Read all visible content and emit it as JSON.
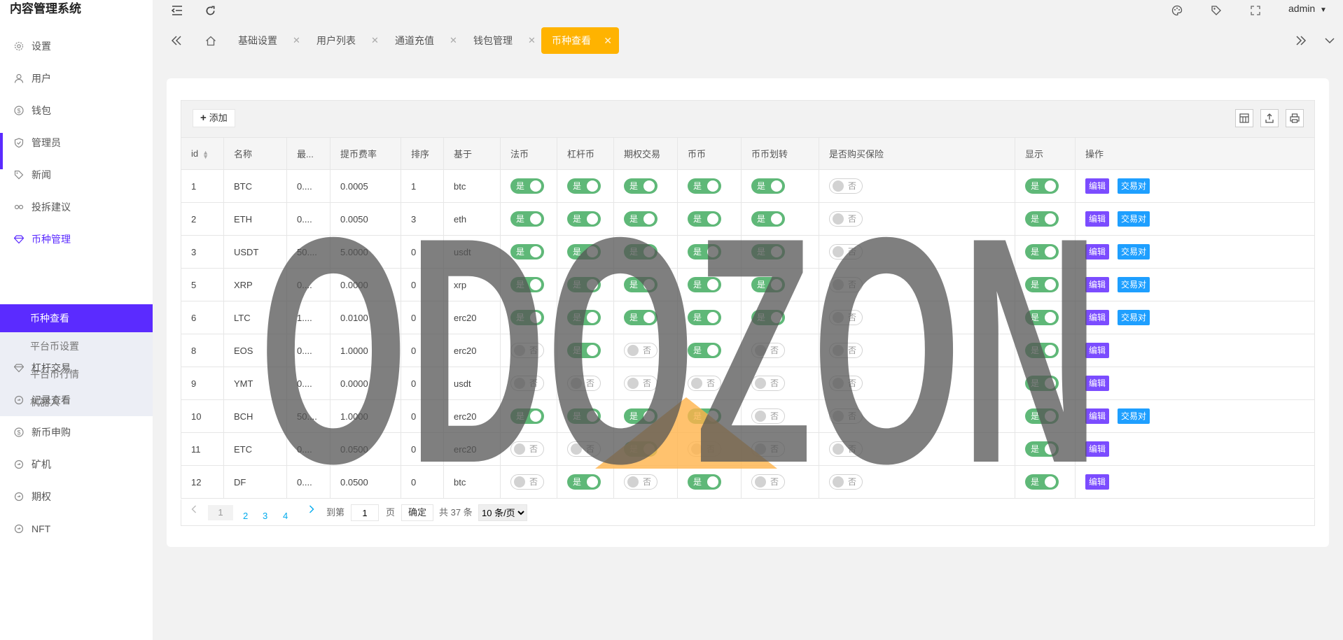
{
  "app": {
    "title": "内容管理系统"
  },
  "sidebar": {
    "items": [
      {
        "label": "设置",
        "icon": "gear-icon"
      },
      {
        "label": "用户",
        "icon": "user-icon"
      },
      {
        "label": "钱包",
        "icon": "dollar-icon"
      },
      {
        "label": "管理员",
        "icon": "shield-icon"
      },
      {
        "label": "新闻",
        "icon": "tag-icon"
      },
      {
        "label": "投拆建议",
        "icon": "link-icon"
      },
      {
        "label": "币种管理",
        "icon": "diamond-icon"
      },
      {
        "label": "杠杆交易",
        "icon": "diamond-icon"
      },
      {
        "label": "记录查看",
        "icon": "cycle-icon"
      },
      {
        "label": "新币申购",
        "icon": "dollar-icon"
      },
      {
        "label": "矿机",
        "icon": "cycle-icon"
      },
      {
        "label": "期权",
        "icon": "cycle-icon"
      },
      {
        "label": "NFT",
        "icon": "cycle-icon"
      }
    ],
    "sub_items": [
      "币种查看",
      "平台币设置",
      "平台币行情",
      "机器人"
    ]
  },
  "topbar": {
    "user": "admin"
  },
  "tabs": [
    "基础设置",
    "用户列表",
    "通道充值",
    "钱包管理"
  ],
  "active_tab": "币种查看",
  "toolbar": {
    "add_label": "添加"
  },
  "table": {
    "columns": [
      "id",
      "名称",
      "最...",
      "提币费率",
      "排序",
      "基于",
      "法币",
      "杠杆币",
      "期权交易",
      "币币",
      "币币划转",
      "是否购买保险",
      "显示",
      "操作"
    ],
    "on_label": "是",
    "off_label": "否",
    "edit_label": "编辑",
    "pair_label": "交易对",
    "rows": [
      {
        "id": "1",
        "name": "BTC",
        "min": "0....",
        "fee": "0.0005",
        "sort": "1",
        "base": "btc",
        "fiat": true,
        "lever": true,
        "option": true,
        "coin": true,
        "transfer": true,
        "insurance": false,
        "show": true,
        "pair": true
      },
      {
        "id": "2",
        "name": "ETH",
        "min": "0....",
        "fee": "0.0050",
        "sort": "3",
        "base": "eth",
        "fiat": true,
        "lever": true,
        "option": true,
        "coin": true,
        "transfer": true,
        "insurance": false,
        "show": true,
        "pair": true
      },
      {
        "id": "3",
        "name": "USDT",
        "min": "50....",
        "fee": "5.0000",
        "sort": "0",
        "base": "usdt",
        "fiat": true,
        "lever": true,
        "option": true,
        "coin": true,
        "transfer": true,
        "insurance": false,
        "show": true,
        "pair": true
      },
      {
        "id": "5",
        "name": "XRP",
        "min": "0....",
        "fee": "0.0000",
        "sort": "0",
        "base": "xrp",
        "fiat": true,
        "lever": true,
        "option": true,
        "coin": true,
        "transfer": true,
        "insurance": false,
        "show": true,
        "pair": true
      },
      {
        "id": "6",
        "name": "LTC",
        "min": "1....",
        "fee": "0.0100",
        "sort": "0",
        "base": "erc20",
        "fiat": true,
        "lever": true,
        "option": true,
        "coin": true,
        "transfer": true,
        "insurance": false,
        "show": true,
        "pair": true
      },
      {
        "id": "8",
        "name": "EOS",
        "min": "0....",
        "fee": "1.0000",
        "sort": "0",
        "base": "erc20",
        "fiat": false,
        "lever": true,
        "option": false,
        "coin": true,
        "transfer": false,
        "insurance": false,
        "show": true,
        "pair": false
      },
      {
        "id": "9",
        "name": "YMT",
        "min": "0....",
        "fee": "0.0000",
        "sort": "0",
        "base": "usdt",
        "fiat": false,
        "lever": false,
        "option": false,
        "coin": false,
        "transfer": false,
        "insurance": false,
        "show": true,
        "pair": false
      },
      {
        "id": "10",
        "name": "BCH",
        "min": "50....",
        "fee": "1.0000",
        "sort": "0",
        "base": "erc20",
        "fiat": true,
        "lever": true,
        "option": true,
        "coin": true,
        "transfer": false,
        "insurance": false,
        "show": true,
        "pair": true
      },
      {
        "id": "11",
        "name": "ETC",
        "min": "0....",
        "fee": "0.0500",
        "sort": "0",
        "base": "erc20",
        "fiat": false,
        "lever": false,
        "option": true,
        "coin": false,
        "transfer": false,
        "insurance": false,
        "show": true,
        "pair": false
      },
      {
        "id": "12",
        "name": "DF",
        "min": "0....",
        "fee": "0.0500",
        "sort": "0",
        "base": "btc",
        "fiat": false,
        "lever": true,
        "option": false,
        "coin": true,
        "transfer": false,
        "insurance": false,
        "show": true,
        "pair": false
      }
    ]
  },
  "pagination": {
    "current": "1",
    "pages": [
      "2",
      "3",
      "4"
    ],
    "goto_label": "到第",
    "page_value": "1",
    "page_unit": "页",
    "confirm_label": "确定",
    "total": "共 37 条",
    "page_size": "10 条/页"
  },
  "watermark": {
    "text": "ODOZON"
  },
  "colors": {
    "accent": "#5b2bff",
    "tab_active": "#ffb300",
    "switch_on": "#5fb878",
    "edit": "#7b4cff",
    "pair": "#1e9fff"
  }
}
